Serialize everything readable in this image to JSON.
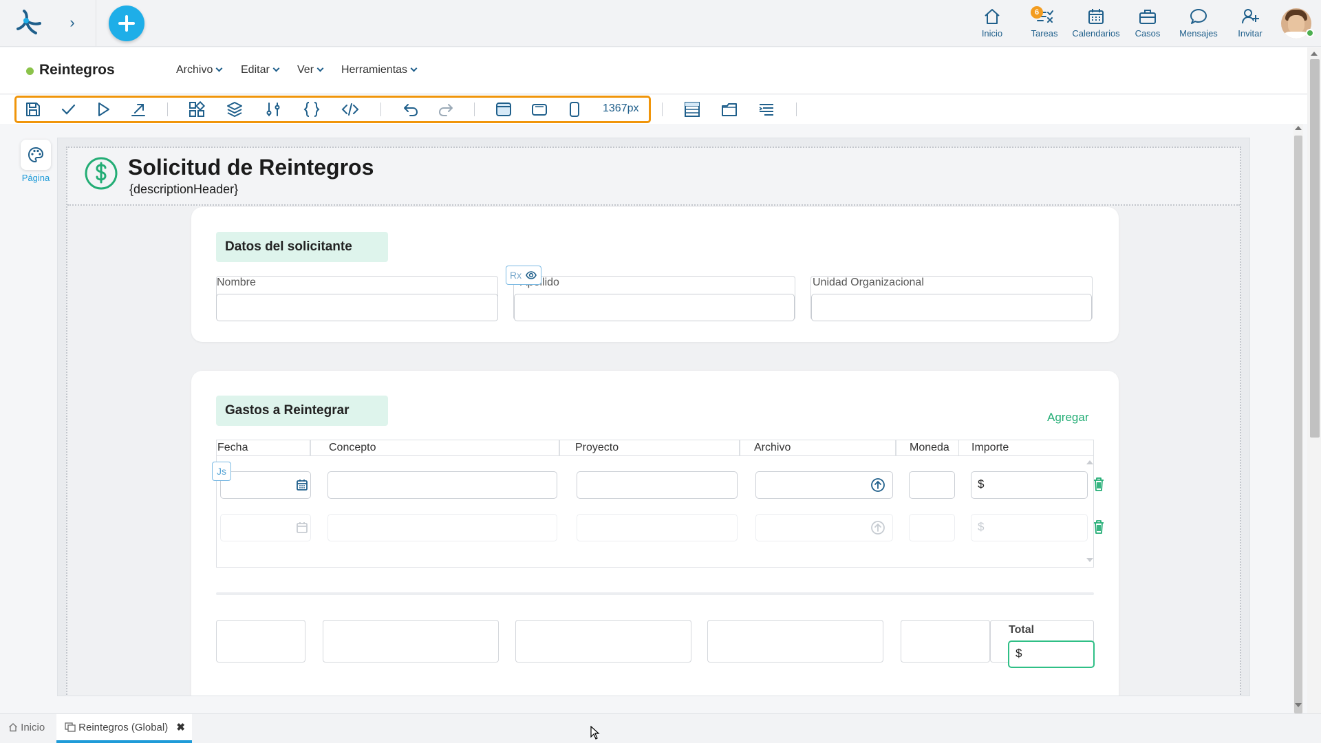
{
  "topbar": {
    "nav": [
      {
        "label": "Inicio",
        "icon": "home-icon"
      },
      {
        "label": "Tareas",
        "icon": "tasks-icon",
        "badge": "6"
      },
      {
        "label": "Calendarios",
        "icon": "calendar-icon"
      },
      {
        "label": "Casos",
        "icon": "briefcase-icon"
      },
      {
        "label": "Mensajes",
        "icon": "message-icon"
      },
      {
        "label": "Invitar",
        "icon": "invite-user-icon"
      }
    ]
  },
  "menubar": {
    "title": "Reintegros",
    "menus": [
      "Archivo",
      "Editar",
      "Ver",
      "Herramientas"
    ]
  },
  "toolbar": {
    "width_label": "1367px"
  },
  "left_panel": {
    "label": "Página"
  },
  "form": {
    "title": "Solicitud de Reintegros",
    "subtitle": "{descriptionHeader}",
    "section1": {
      "title": "Datos del solicitante",
      "fields": [
        "Nombre",
        "Apellido",
        "Unidad Organizacional"
      ],
      "rx_badge": "Rx"
    },
    "section2": {
      "title": "Gastos a Reintegrar",
      "add_label": "Agregar",
      "js_badge": "Js",
      "columns": [
        "Fecha",
        "Concepto",
        "Proyecto",
        "Archivo",
        "Moneda",
        "Importe"
      ],
      "currency_symbol": "$",
      "total_label": "Total",
      "total_value": "$"
    }
  },
  "bottom_tabs": [
    {
      "label": "Inicio",
      "active": false
    },
    {
      "label": "Reintegros (Global)",
      "active": true
    }
  ],
  "colors": {
    "accent_blue": "#1f5f8b",
    "add_button": "#1eaee8",
    "green": "#23ad75",
    "highlight_orange": "#f0950a",
    "badge_orange": "#f39c1f"
  }
}
